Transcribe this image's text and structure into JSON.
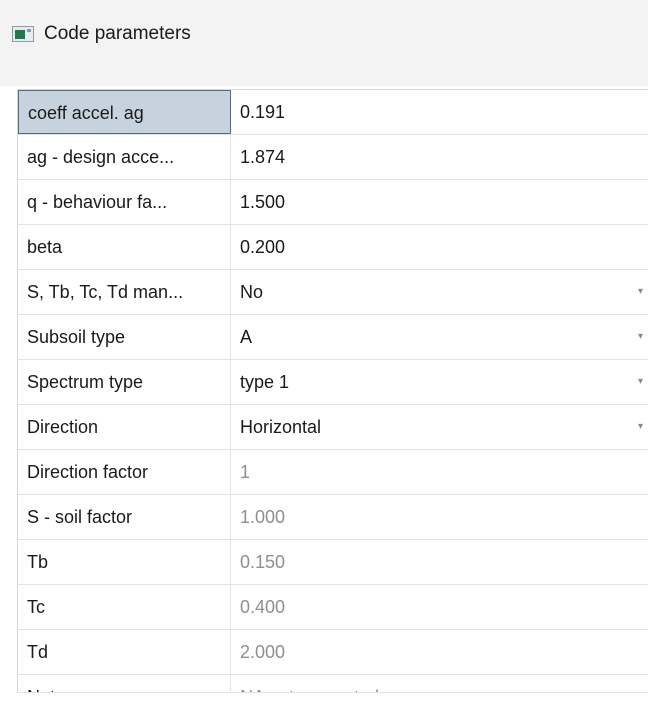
{
  "window": {
    "title": "Code parameters",
    "icon": "window-icon"
  },
  "params": [
    {
      "label": "coeff accel. ag",
      "value": "0.191",
      "editable": true,
      "dropdown": false,
      "selected": true
    },
    {
      "label": "ag - design acce...",
      "value": "1.874",
      "editable": true,
      "dropdown": false
    },
    {
      "label": "q - behaviour fa...",
      "value": "1.500",
      "editable": true,
      "dropdown": false
    },
    {
      "label": "beta",
      "value": "0.200",
      "editable": true,
      "dropdown": false
    },
    {
      "label": "S, Tb, Tc, Td man...",
      "value": "No",
      "editable": true,
      "dropdown": true
    },
    {
      "label": "Subsoil type",
      "value": "A",
      "editable": true,
      "dropdown": true
    },
    {
      "label": "Spectrum type",
      "value": "type 1",
      "editable": true,
      "dropdown": true
    },
    {
      "label": "Direction",
      "value": "Horizontal",
      "editable": true,
      "dropdown": true
    },
    {
      "label": "Direction factor",
      "value": "1",
      "editable": false,
      "dropdown": false
    },
    {
      "label": "S - soil factor",
      "value": "1.000",
      "editable": false,
      "dropdown": false
    },
    {
      "label": "Tb",
      "value": "0.150",
      "editable": false,
      "dropdown": false
    },
    {
      "label": "Tc",
      "value": "0.400",
      "editable": false,
      "dropdown": false
    },
    {
      "label": "Td",
      "value": "2.000",
      "editable": false,
      "dropdown": false
    },
    {
      "label": "Note",
      "value": "NA not supported",
      "editable": false,
      "dropdown": false,
      "partial": true
    }
  ],
  "colors": {
    "selected_bg": "#c6d3df",
    "selected_border": "#4f6a85",
    "readonly_text": "#8f8f8f",
    "header_bg": "#f3f3f3"
  }
}
